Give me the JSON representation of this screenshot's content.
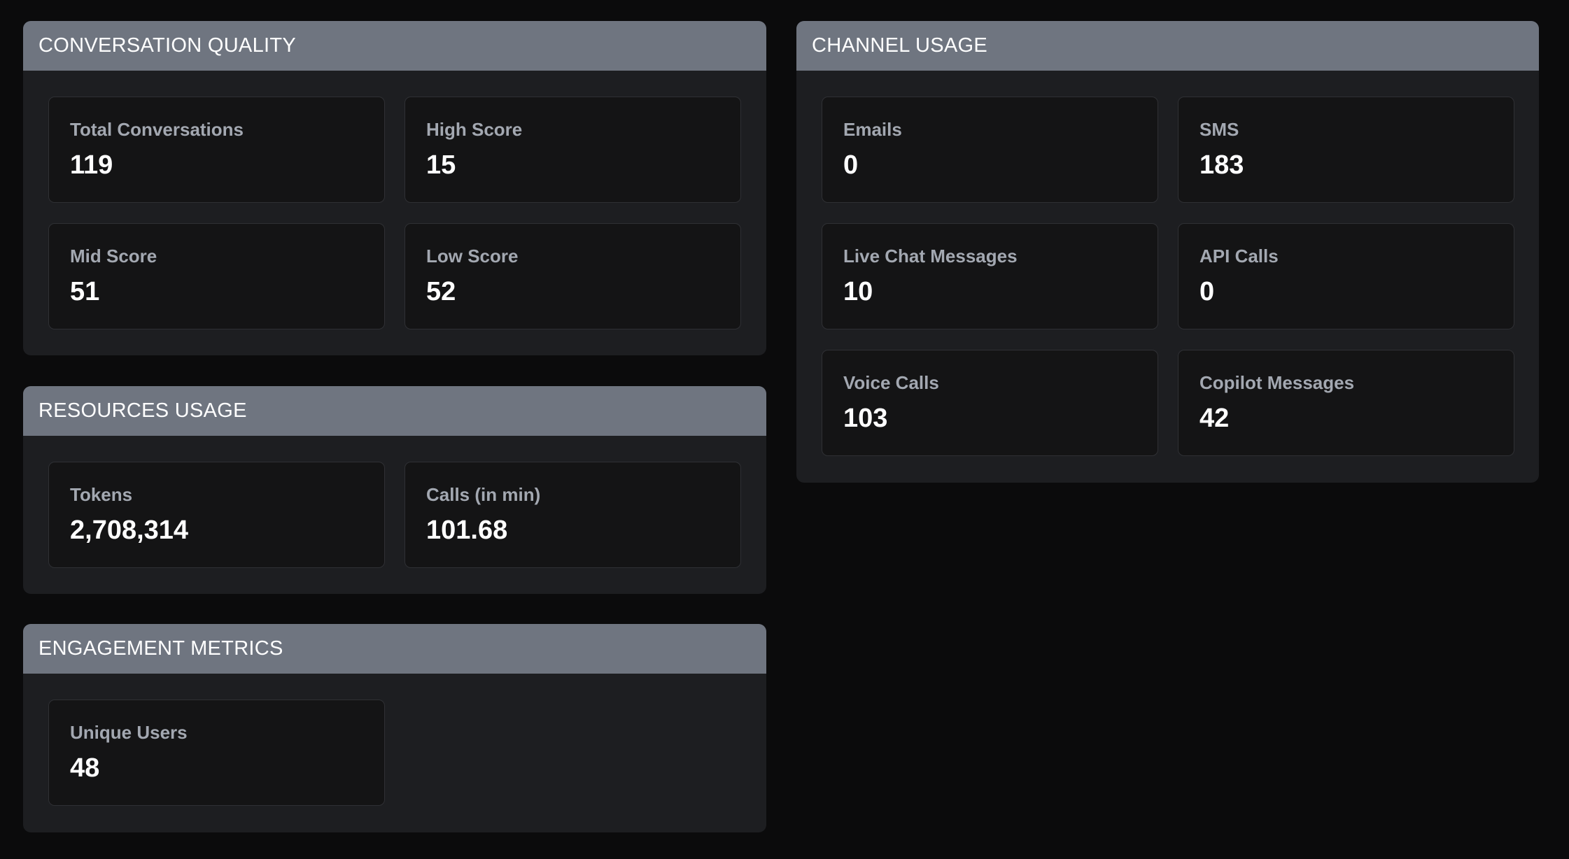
{
  "conversation_quality": {
    "title": "CONVERSATION QUALITY",
    "cards": [
      {
        "label": "Total Conversations",
        "value": "119"
      },
      {
        "label": "High Score",
        "value": "15"
      },
      {
        "label": "Mid Score",
        "value": "51"
      },
      {
        "label": "Low Score",
        "value": "52"
      }
    ]
  },
  "resources_usage": {
    "title": "RESOURCES USAGE",
    "cards": [
      {
        "label": "Tokens",
        "value": "2,708,314"
      },
      {
        "label": "Calls (in min)",
        "value": "101.68"
      }
    ]
  },
  "engagement_metrics": {
    "title": "ENGAGEMENT METRICS",
    "cards": [
      {
        "label": "Unique Users",
        "value": "48"
      }
    ]
  },
  "channel_usage": {
    "title": "CHANNEL USAGE",
    "cards": [
      {
        "label": "Emails",
        "value": "0"
      },
      {
        "label": "SMS",
        "value": "183"
      },
      {
        "label": "Live Chat Messages",
        "value": "10"
      },
      {
        "label": "API Calls",
        "value": "0"
      },
      {
        "label": "Voice Calls",
        "value": "103"
      },
      {
        "label": "Copilot Messages",
        "value": "42"
      }
    ]
  },
  "colors": {
    "page_background": "#0b0b0c",
    "panel_background": "#1d1e21",
    "panel_header": "#6f7580",
    "card_background": "#141415",
    "card_border": "#2f3034",
    "label_text": "#a3a8b1",
    "value_text": "#ffffff"
  }
}
